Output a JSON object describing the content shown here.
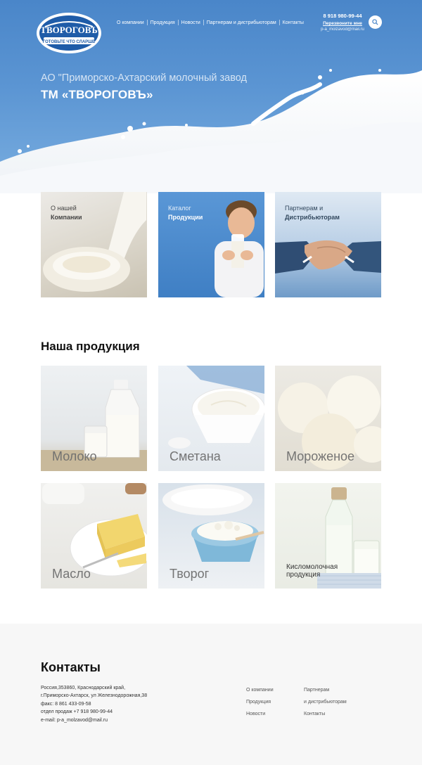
{
  "header": {
    "logo_text": "ТВОРОГОВЪ",
    "logo_tagline": "ГОТОВЬТЕ ЧТО СЛАРШЕ",
    "nav": [
      "О компании",
      "Продукция",
      "Новости",
      "Партнерам и дистрибьюторам",
      "Контакты"
    ],
    "phone": "8 918 980-99-44",
    "callback": "Перезвоните мне",
    "email": "p-a_molzavod@mail.ru",
    "search_icon": "search-icon"
  },
  "hero": {
    "subtitle": "АО \"Приморско-Ахтарский молочный завод",
    "title": "ТМ «ТВОРОГОВЪ»"
  },
  "categories": [
    {
      "line1": "О нашей",
      "line2": "Компании"
    },
    {
      "line1": "Каталог",
      "line2": "Продукции"
    },
    {
      "line1": "Партнерам и",
      "line2": "Дистрибьюторам"
    }
  ],
  "products_section": {
    "title": "Наша продукция",
    "items": [
      "Молоко",
      "Сметана",
      "Мороженое",
      "Масло",
      "Творог",
      "Кисломолочная продукция"
    ]
  },
  "footer": {
    "title": "Контакты",
    "address_lines": [
      "Россия,353860, Краснодарский край,",
      "г.Приморско-Ахтарск, ул Железнодорожная,38",
      "факс: 8 861 433-09-58",
      "отдел продаж +7 918 980-99-44",
      "e-mail: p-a_molzavod@mail.ru"
    ],
    "links_col1": [
      "О компании",
      "Продукция",
      "Новости"
    ],
    "links_col2": [
      "Партнерам",
      "и дистрибьюторам",
      "Контакты"
    ]
  },
  "colors": {
    "hero_blue": "#4a86c9",
    "footer_bg": "#f7f7f7",
    "catalog_blue": "#4f8ccd"
  }
}
